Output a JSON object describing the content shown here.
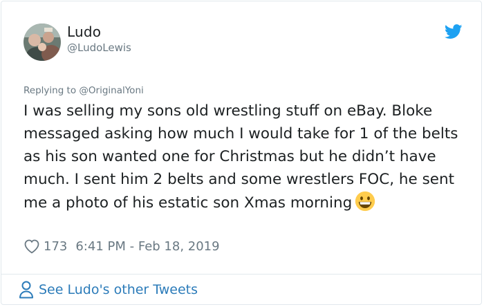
{
  "author": {
    "name": "Ludo",
    "handle": "@LudoLewis",
    "avatar_icon": "profile-photo"
  },
  "brand": {
    "icon": "twitter-bird-icon",
    "color": "#1da1f2"
  },
  "reply": {
    "prefix": "Replying to ",
    "mention": "@OriginalYoni"
  },
  "tweet": {
    "text": "I was selling my sons old wrestling stuff on eBay. Bloke messaged asking how much I would take for 1 of the belts as his son wanted one for Christmas but he didn’t have much. I sent him 2 belts and some wrestlers FOC, he sent me a photo of his estatic son Xmas morning",
    "emoji": "grinning-face-emoji"
  },
  "stats": {
    "likes": "173",
    "timestamp": "6:41 PM - Feb 18, 2019"
  },
  "footer": {
    "link_label": "See Ludo's other Tweets",
    "link_color": "#2b7bb9"
  }
}
